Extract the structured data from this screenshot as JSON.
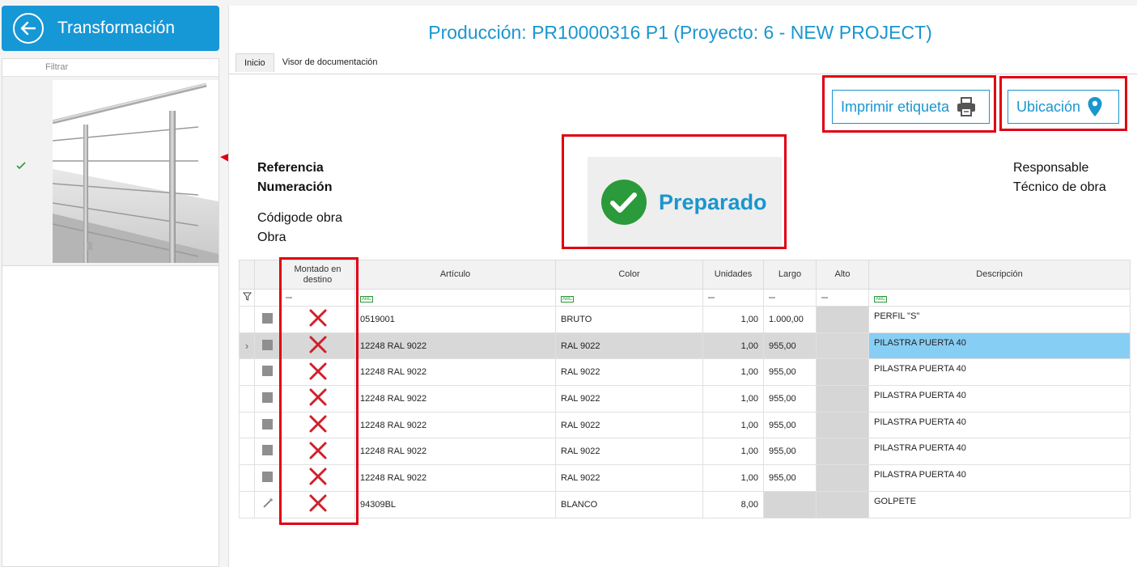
{
  "sidebar": {
    "title": "Transformación",
    "filter_label": "Filtrar"
  },
  "header": {
    "title": "Producción: PR10000316 P1 (Proyecto: 6 - NEW PROJECT)"
  },
  "tabs": [
    {
      "label": "Inicio",
      "active": true
    },
    {
      "label": "Visor de documentación",
      "active": false
    }
  ],
  "actions": {
    "print_label": "Imprimir etiqueta",
    "location_label": "Ubicación"
  },
  "info_left": {
    "referencia": "Referencia",
    "numeracion": "Numeración",
    "codigo_obra": "Códigode obra",
    "obra": "Obra"
  },
  "info_right": {
    "responsable": "Responsable",
    "tecnico": "Técnico de obra"
  },
  "status": {
    "label": "Preparado",
    "color": "#1a96cf"
  },
  "table": {
    "columns": [
      "Montado en destino",
      "Artículo",
      "Color",
      "Unidades",
      "Largo",
      "Alto",
      "Descripción"
    ],
    "rows": [
      {
        "articulo": "0519001",
        "color": "BRUTO",
        "unidades": "1,00",
        "largo": "1.000,00",
        "alto": "",
        "descripcion": "PERFIL \"S\"",
        "icon": "square",
        "expand": ""
      },
      {
        "articulo": "12248 RAL 9022",
        "color": "RAL 9022",
        "unidades": "1,00",
        "largo": "955,00",
        "alto": "",
        "descripcion": "PILASTRA PUERTA 40",
        "icon": "square",
        "expand": "›",
        "selected": true
      },
      {
        "articulo": "12248 RAL 9022",
        "color": "RAL 9022",
        "unidades": "1,00",
        "largo": "955,00",
        "alto": "",
        "descripcion": "PILASTRA PUERTA 40",
        "icon": "square",
        "expand": ""
      },
      {
        "articulo": "12248 RAL 9022",
        "color": "RAL 9022",
        "unidades": "1,00",
        "largo": "955,00",
        "alto": "",
        "descripcion": "PILASTRA PUERTA 40",
        "icon": "square",
        "expand": ""
      },
      {
        "articulo": "12248 RAL 9022",
        "color": "RAL 9022",
        "unidades": "1,00",
        "largo": "955,00",
        "alto": "",
        "descripcion": "PILASTRA PUERTA 40",
        "icon": "square",
        "expand": ""
      },
      {
        "articulo": "12248 RAL 9022",
        "color": "RAL 9022",
        "unidades": "1,00",
        "largo": "955,00",
        "alto": "",
        "descripcion": "PILASTRA PUERTA 40",
        "icon": "square",
        "expand": ""
      },
      {
        "articulo": "12248 RAL 9022",
        "color": "RAL 9022",
        "unidades": "1,00",
        "largo": "955,00",
        "alto": "",
        "descripcion": "PILASTRA PUERTA 40",
        "icon": "square",
        "expand": ""
      },
      {
        "articulo": "94309BL",
        "color": "BLANCO",
        "unidades": "8,00",
        "largo": "",
        "alto": "",
        "descripcion": "GOLPETE",
        "icon": "tool",
        "expand": ""
      }
    ]
  },
  "colors": {
    "accent": "#1697d6",
    "highlight_box": "#e00010",
    "selected_desc": "#87cef5",
    "x_mark": "#d0202a"
  }
}
